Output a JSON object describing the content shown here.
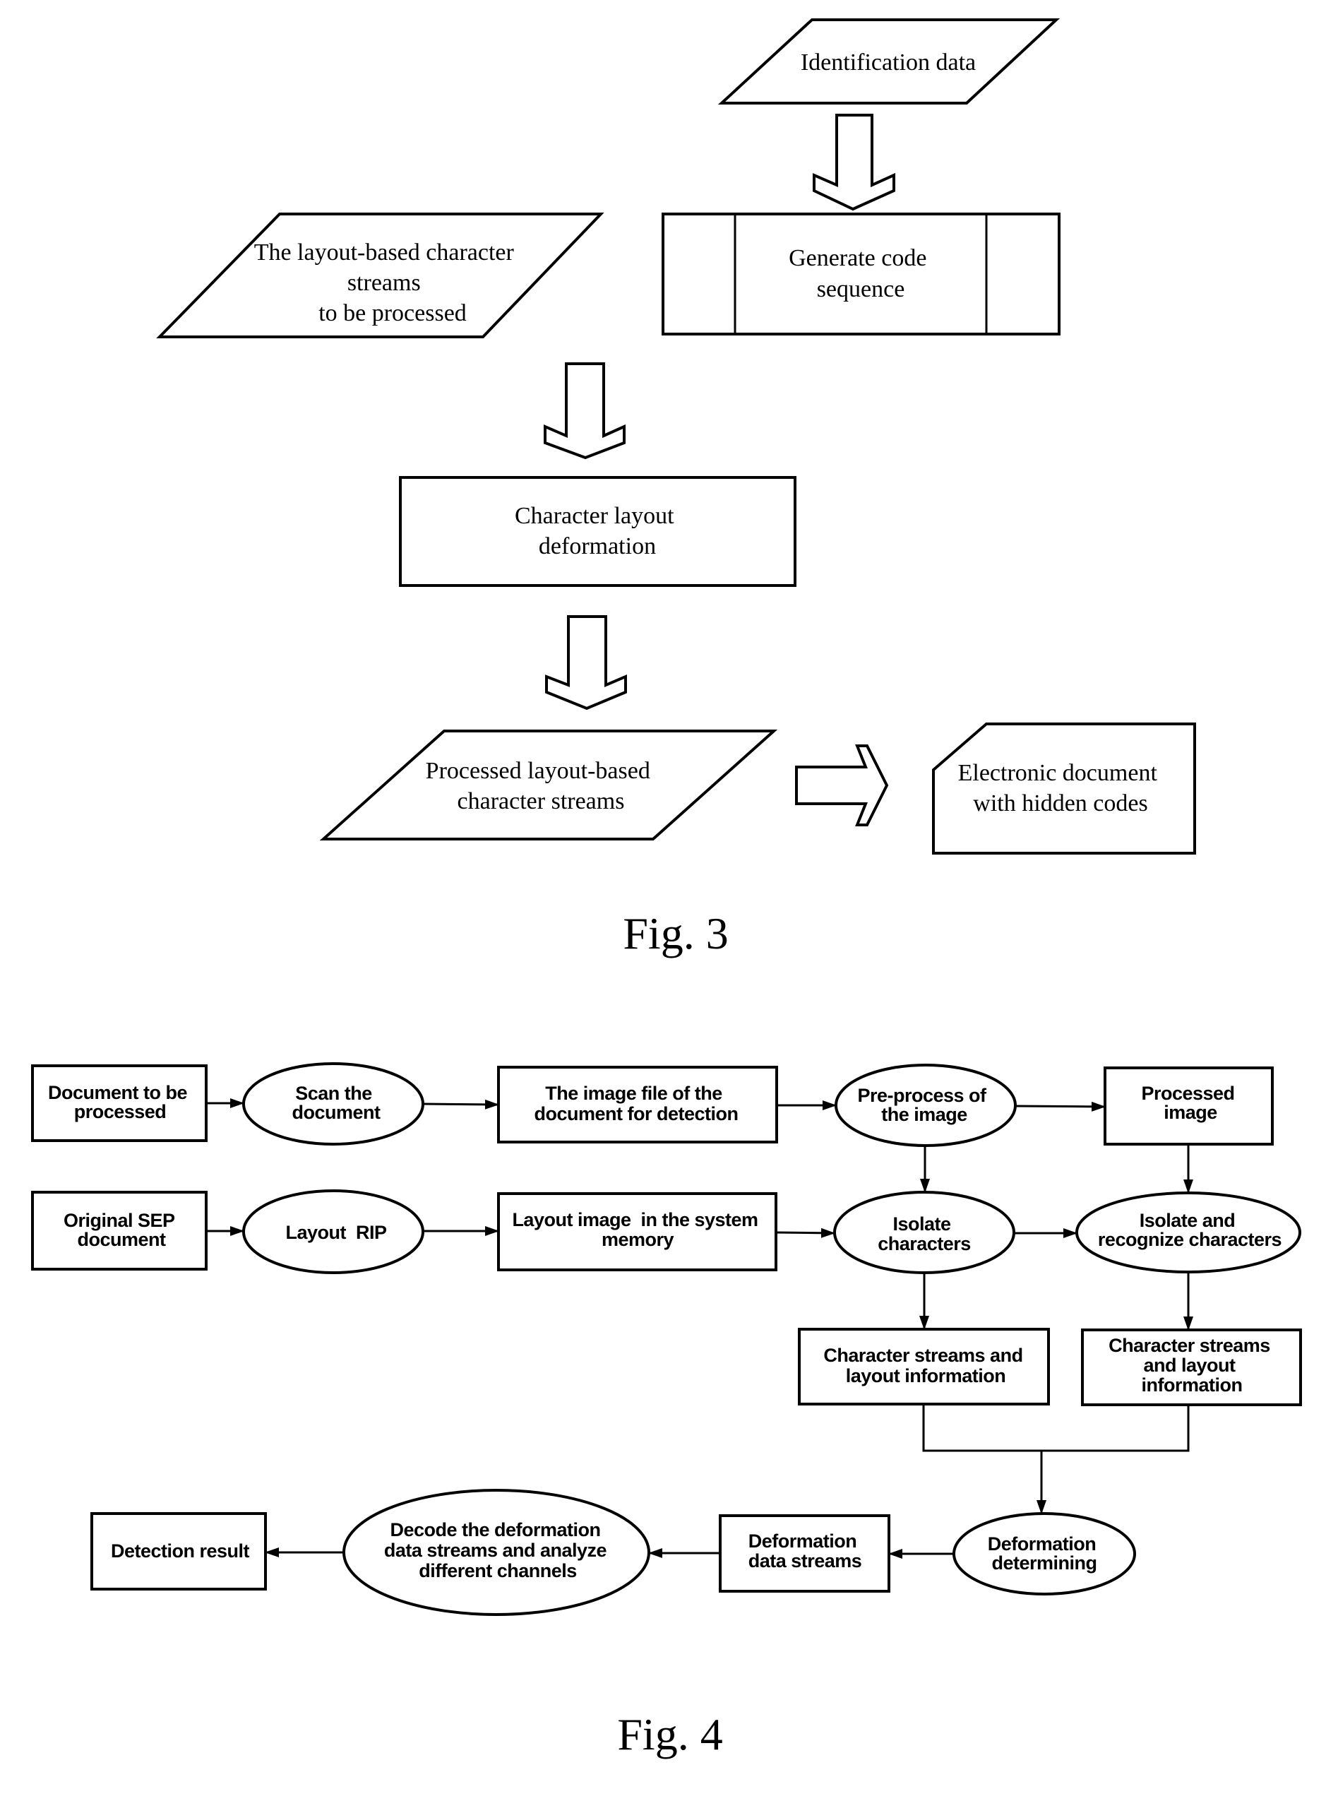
{
  "fig3": {
    "caption": "Fig. 3",
    "identification_data": {
      "lines": [
        "Identification data"
      ]
    },
    "generate_code_sequence": {
      "lines": [
        "Generate code",
        "sequence"
      ]
    },
    "layout_streams_input": {
      "lines": [
        "The layout-based character",
        "streams",
        "to be processed"
      ]
    },
    "character_layout_deformation": {
      "lines": [
        "Character layout",
        "deformation"
      ]
    },
    "processed_streams": {
      "lines": [
        "Processed layout-based",
        "character streams"
      ]
    },
    "electronic_document": {
      "lines": [
        "Electronic document",
        "with hidden codes"
      ]
    }
  },
  "fig4": {
    "caption": "Fig. 4",
    "document_to_be_processed": {
      "lines": [
        "Document to be",
        "processed"
      ]
    },
    "scan_the_document": {
      "lines": [
        "Scan the",
        "document"
      ]
    },
    "image_file_for_detection": {
      "lines": [
        "The image file of the",
        "document for detection"
      ]
    },
    "pre_process_image": {
      "lines": [
        "Pre-process of",
        "the image"
      ]
    },
    "processed_image": {
      "lines": [
        "Processed",
        "image"
      ]
    },
    "original_sep_document": {
      "lines": [
        "Original SEP",
        "document"
      ]
    },
    "layout_rip": {
      "lines": [
        "Layout  RIP"
      ]
    },
    "layout_image_memory": {
      "lines": [
        "Layout image  in the system",
        "memory"
      ]
    },
    "isolate_characters": {
      "lines": [
        "Isolate",
        "characters"
      ]
    },
    "isolate_recognize_characters": {
      "lines": [
        "Isolate and",
        "recognize characters"
      ]
    },
    "char_streams_layout_info_1": {
      "lines": [
        "Character streams and",
        "layout information"
      ]
    },
    "char_streams_layout_info_2": {
      "lines": [
        "Character streams",
        "and layout",
        "information"
      ]
    },
    "deformation_determining": {
      "lines": [
        "Deformation",
        "determining"
      ]
    },
    "deformation_data_streams": {
      "lines": [
        "Deformation",
        "data streams"
      ]
    },
    "decode_deformation": {
      "lines": [
        "Decode the deformation",
        "data streams and analyze",
        "different channels"
      ]
    },
    "detection_result": {
      "lines": [
        "Detection result"
      ]
    }
  }
}
